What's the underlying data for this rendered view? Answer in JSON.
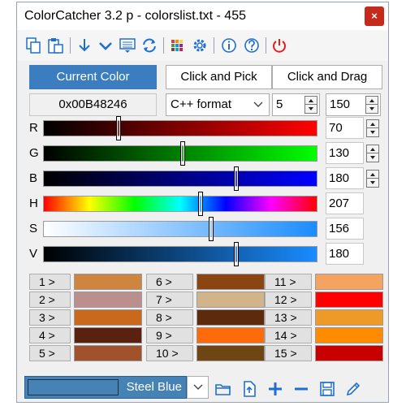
{
  "window": {
    "title": "ColorCatcher 3.2 p - colorslist.txt - 455",
    "close_label": "×"
  },
  "toolbar": {
    "items": [
      {
        "name": "copy-icon"
      },
      {
        "name": "paste-icon"
      },
      {
        "name": "arrow-down-icon"
      },
      {
        "name": "chevron-down-icon"
      },
      {
        "name": "screen-capture-icon"
      },
      {
        "name": "refresh-icon"
      },
      {
        "name": "palette-icon"
      },
      {
        "name": "settings-gear-icon"
      },
      {
        "name": "info-icon"
      },
      {
        "name": "help-icon"
      },
      {
        "name": "power-icon"
      }
    ]
  },
  "modes": {
    "current_color": "Current Color",
    "click_and_pick": "Click and Pick",
    "click_and_drag": "Click and Drag"
  },
  "format": {
    "hex_value": "0x00B48246",
    "format_select": "C++ format",
    "spin1": "5",
    "spin2": "150"
  },
  "sliders": [
    {
      "label": "R",
      "value": "70",
      "fraction": 0.275,
      "spinner": true
    },
    {
      "label": "G",
      "value": "130",
      "fraction": 0.51,
      "spinner": true
    },
    {
      "label": "B",
      "value": "180",
      "fraction": 0.706,
      "spinner": true
    },
    {
      "label": "H",
      "value": "207",
      "fraction": 0.575,
      "spinner": false
    },
    {
      "label": "S",
      "value": "156",
      "fraction": 0.612,
      "spinner": false
    },
    {
      "label": "V",
      "value": "180",
      "fraction": 0.706,
      "spinner": false
    }
  ],
  "palette": [
    {
      "label": "1 >",
      "color": "#cd853f"
    },
    {
      "label": "2 >",
      "color": "#bc8f8f"
    },
    {
      "label": "3 >",
      "color": "#c8691e"
    },
    {
      "label": "4 >",
      "color": "#5a2010"
    },
    {
      "label": "5 >",
      "color": "#a0522d"
    },
    {
      "label": "6 >",
      "color": "#8b4513"
    },
    {
      "label": "7 >",
      "color": "#d2b48c"
    },
    {
      "label": "8 >",
      "color": "#5e2a0e"
    },
    {
      "label": "9 >",
      "color": "#ff6a0a"
    },
    {
      "label": "10 >",
      "color": "#6e4614"
    },
    {
      "label": "11 >",
      "color": "#f4a460"
    },
    {
      "label": "12 >",
      "color": "#ff0000"
    },
    {
      "label": "13 >",
      "color": "#ee9a28"
    },
    {
      "label": "14 >",
      "color": "#ff8c00"
    },
    {
      "label": "15 >",
      "color": "#c80000"
    }
  ],
  "bottom": {
    "preset_name": "Steel Blue",
    "preset_color": "#4682b4",
    "icons": [
      "open-folder-icon",
      "import-file-icon",
      "add-plus-icon",
      "remove-minus-icon",
      "save-disk-icon",
      "edit-pencil-icon"
    ]
  }
}
